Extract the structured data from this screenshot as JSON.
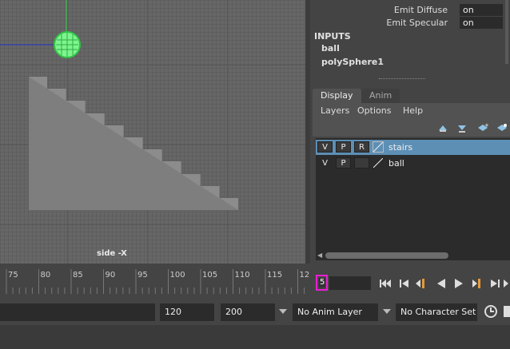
{
  "viewport": {
    "label": "side -X"
  },
  "attributes": [
    {
      "label": "Emit Diffuse",
      "value": "on"
    },
    {
      "label": "Emit Specular",
      "value": "on"
    }
  ],
  "inputs": {
    "title": "INPUTS",
    "items": [
      "ball",
      "polySphere1"
    ]
  },
  "layer_editor": {
    "tabs": [
      "Display",
      "Anim"
    ],
    "active_tab": "Display",
    "menu": [
      "Layers",
      "Options",
      "Help"
    ],
    "tool_icons": [
      "move-layer-up-icon",
      "move-layer-down-icon",
      "create-layer-icon",
      "create-layer-from-selected-icon"
    ],
    "layers": [
      {
        "name": "stairs",
        "v": "V",
        "p": "P",
        "r": "R",
        "selected": true,
        "color": "#4f8ab0"
      },
      {
        "name": "ball",
        "v": "V",
        "p": "P",
        "r": "",
        "selected": false,
        "color": "#2b2b2b"
      }
    ]
  },
  "timeline": {
    "ticks": [
      "75",
      "80",
      "85",
      "90",
      "95",
      "100",
      "105",
      "110",
      "115",
      "12"
    ],
    "current_frame": "5",
    "highlight_color": "#e81fd2"
  },
  "range": {
    "end_time": "120",
    "max_time": "200",
    "anim_layer": "No Anim Layer",
    "character_set": "No Character Set"
  },
  "colors": {
    "ball": "#5ef07a",
    "stairs": "#7e7e7e",
    "selected_row": "#5d8fb5"
  }
}
